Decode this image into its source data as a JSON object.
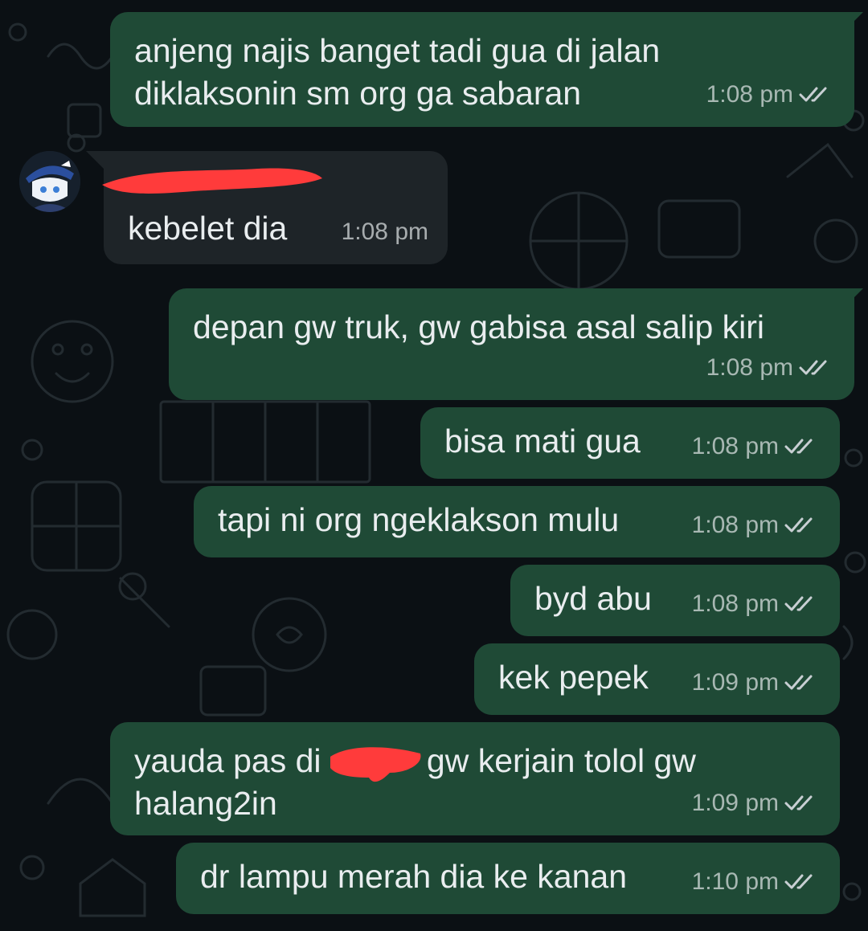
{
  "chat": {
    "messages": [
      {
        "id": "m1",
        "direction": "out",
        "text": "anjeng najis banget tadi gua di jalan\ndiklaksonin sm org ga sabaran",
        "time": "1:08 pm",
        "status": "read"
      },
      {
        "id": "m2",
        "direction": "in",
        "sender": "",
        "text": "kebelet dia",
        "time": "1:08 pm"
      },
      {
        "id": "m3",
        "direction": "out",
        "text": "depan gw truk, gw gabisa asal salip kiri",
        "time": "1:08 pm",
        "status": "read"
      },
      {
        "id": "m4",
        "direction": "out",
        "text": "bisa mati gua",
        "time": "1:08 pm",
        "status": "read"
      },
      {
        "id": "m5",
        "direction": "out",
        "text": "tapi ni org ngeklakson mulu",
        "time": "1:08 pm",
        "status": "read"
      },
      {
        "id": "m6",
        "direction": "out",
        "text": "byd abu",
        "time": "1:08 pm",
        "status": "read"
      },
      {
        "id": "m7",
        "direction": "out",
        "text": "kek pepek",
        "time": "1:09 pm",
        "status": "read"
      },
      {
        "id": "m8",
        "direction": "out",
        "text_before": "yauda pas di ",
        "text_after": "gw kerjain tolol gw\nhalang2in",
        "time": "1:09 pm",
        "status": "read"
      },
      {
        "id": "m9",
        "direction": "out",
        "text": "dr lampu merah dia ke kanan",
        "time": "1:10 pm",
        "status": "read"
      }
    ]
  },
  "colors": {
    "background": "#0b1014",
    "outgoing_bubble": "#1f4a36",
    "incoming_bubble": "#1e2428",
    "redaction": "#ff3b3b",
    "read_ticks": "#c8cfd3"
  },
  "icons": {
    "read_receipt": "double-check-icon",
    "avatar": "contact-avatar"
  }
}
